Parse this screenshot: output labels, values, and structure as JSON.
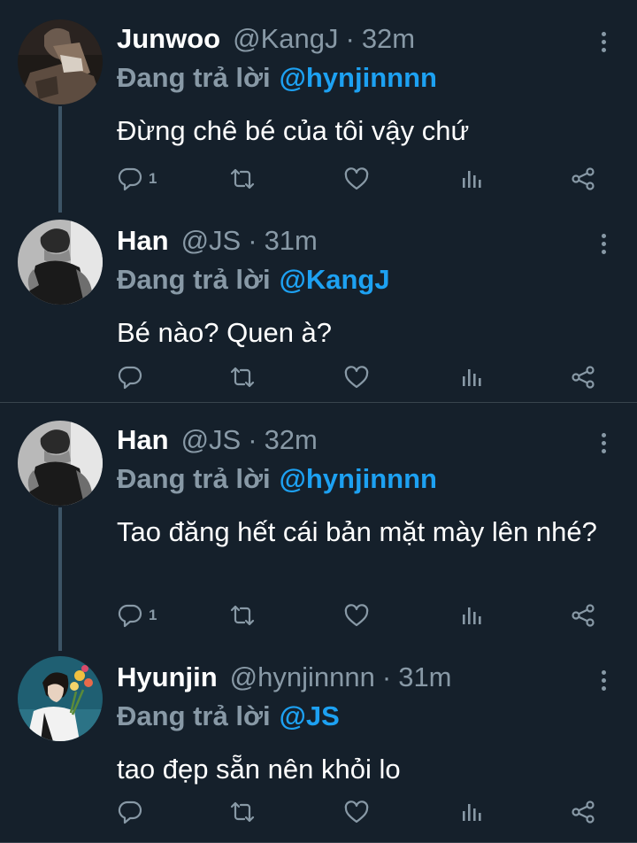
{
  "colors": {
    "background": "#15202b",
    "text": "#ffffff",
    "muted": "#8899a6",
    "accent": "#1da1f2",
    "divider": "#38444d",
    "thread_line": "#3d5466"
  },
  "tweets": [
    {
      "name": "Junwoo",
      "handle": "@KangJ",
      "dot": "·",
      "time": "32m",
      "replying_prefix": "Đang trả lời",
      "replying_to": "@hynjinnnn",
      "text": "Đừng chê bé của tôi vậy chứ",
      "reply_count": "1",
      "avatar_icon": "junwoo-avatar"
    },
    {
      "name": "Han",
      "handle": "@JS",
      "dot": "·",
      "time": "31m",
      "replying_prefix": "Đang trả lời",
      "replying_to": "@KangJ",
      "text": "Bé nào? Quen à?",
      "reply_count": "",
      "avatar_icon": "han-avatar"
    },
    {
      "name": "Han",
      "handle": "@JS",
      "dot": "·",
      "time": "32m",
      "replying_prefix": "Đang trả lời",
      "replying_to": "@hynjinnnn",
      "text": "Tao đăng hết cái bản mặt mày lên nhé?",
      "reply_count": "1",
      "avatar_icon": "han-avatar"
    },
    {
      "name": "Hyunjin",
      "handle": "@hynjinnnn",
      "dot": "·",
      "time": "31m",
      "replying_prefix": "Đang trả lời",
      "replying_to": "@JS",
      "text": "tao đẹp sẵn nên khỏi lo",
      "reply_count": "",
      "avatar_icon": "hyunjin-avatar"
    }
  ],
  "action_icons": [
    "reply-icon",
    "retweet-icon",
    "like-icon",
    "analytics-icon",
    "share-icon"
  ]
}
